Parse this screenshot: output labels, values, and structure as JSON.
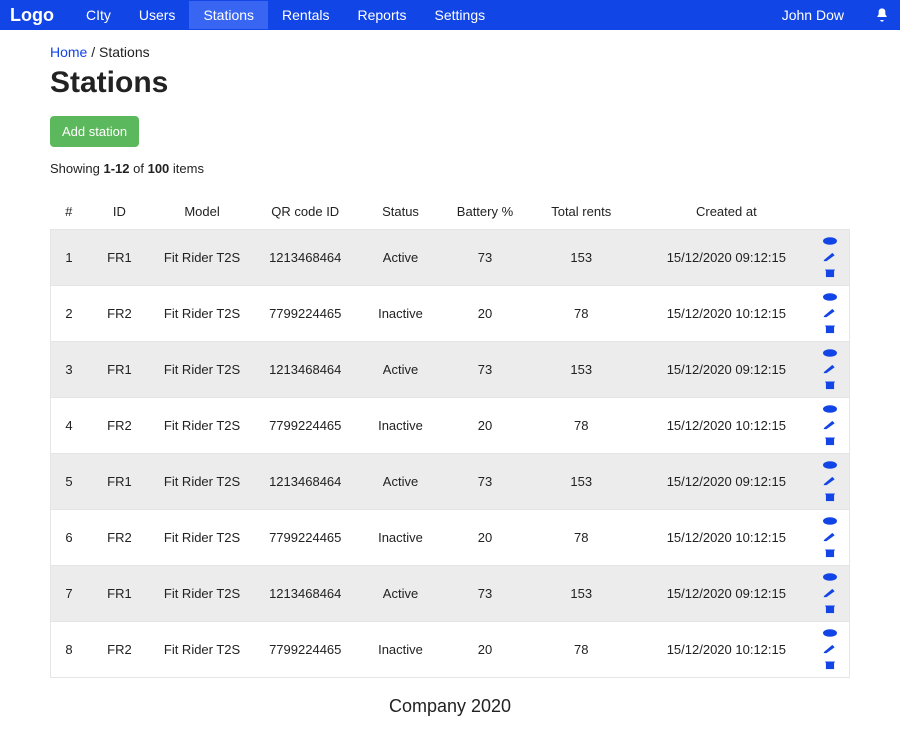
{
  "nav": {
    "logo": "Logo",
    "items": [
      {
        "label": "CIty",
        "active": false
      },
      {
        "label": "Users",
        "active": false
      },
      {
        "label": "Stations",
        "active": true
      },
      {
        "label": "Rentals",
        "active": false
      },
      {
        "label": "Reports",
        "active": false
      },
      {
        "label": "Settings",
        "active": false
      }
    ],
    "user": "John Dow"
  },
  "breadcrumb": {
    "home_label": "Home",
    "sep": " / ",
    "current": "Stations"
  },
  "page": {
    "title": "Stations",
    "add_button": "Add station",
    "showing_prefix": "Showing ",
    "showing_range": "1-12",
    "showing_mid": " of ",
    "showing_total": "100",
    "showing_suffix": " items"
  },
  "table": {
    "headers": {
      "num": "#",
      "id": "ID",
      "model": "Model",
      "qr": "QR code ID",
      "status": "Status",
      "battery": "Battery %",
      "rents": "Total rents",
      "created": "Created at"
    },
    "rows": [
      {
        "num": "1",
        "id": "FR1",
        "model": "Fit Rider T2S",
        "qr": "1213468464",
        "status": "Active",
        "battery": "73",
        "rents": "153",
        "created": "15/12/2020 09:12:15"
      },
      {
        "num": "2",
        "id": "FR2",
        "model": "Fit Rider T2S",
        "qr": "7799224465",
        "status": "Inactive",
        "battery": "20",
        "rents": "78",
        "created": "15/12/2020 10:12:15"
      },
      {
        "num": "3",
        "id": "FR1",
        "model": "Fit Rider T2S",
        "qr": "1213468464",
        "status": "Active",
        "battery": "73",
        "rents": "153",
        "created": "15/12/2020 09:12:15"
      },
      {
        "num": "4",
        "id": "FR2",
        "model": "Fit Rider T2S",
        "qr": "7799224465",
        "status": "Inactive",
        "battery": "20",
        "rents": "78",
        "created": "15/12/2020 10:12:15"
      },
      {
        "num": "5",
        "id": "FR1",
        "model": "Fit Rider T2S",
        "qr": "1213468464",
        "status": "Active",
        "battery": "73",
        "rents": "153",
        "created": "15/12/2020 09:12:15"
      },
      {
        "num": "6",
        "id": "FR2",
        "model": "Fit Rider T2S",
        "qr": "7799224465",
        "status": "Inactive",
        "battery": "20",
        "rents": "78",
        "created": "15/12/2020 10:12:15"
      },
      {
        "num": "7",
        "id": "FR1",
        "model": "Fit Rider T2S",
        "qr": "1213468464",
        "status": "Active",
        "battery": "73",
        "rents": "153",
        "created": "15/12/2020 09:12:15"
      },
      {
        "num": "8",
        "id": "FR2",
        "model": "Fit Rider T2S",
        "qr": "7799224465",
        "status": "Inactive",
        "battery": "20",
        "rents": "78",
        "created": "15/12/2020 10:12:15"
      }
    ]
  },
  "footer": {
    "text": "Company 2020"
  }
}
